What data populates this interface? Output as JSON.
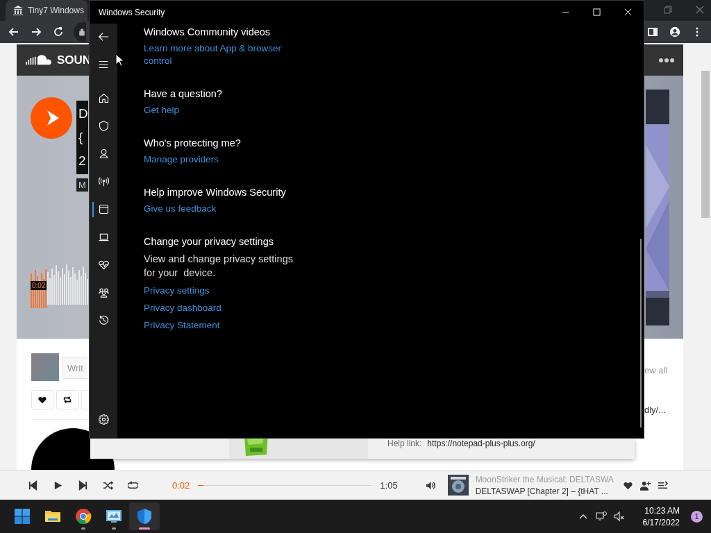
{
  "browser": {
    "tab_title": "Tiny7 Windows"
  },
  "soundcloud": {
    "logo_text": "SOUN",
    "title_lines": [
      "D",
      "{",
      "2"
    ],
    "tag": "M",
    "waveform_time": "0:02",
    "comment_placeholder": "Writ",
    "view_all": "ew all",
    "link_fragment": "dly/..."
  },
  "help_window": {
    "label": "Help link:",
    "url": "https://notepad-plus-plus.org/"
  },
  "player": {
    "elapsed": "0:02",
    "duration": "1:05",
    "level": 0.03,
    "track_artist": "MoonStriker the Musical: DELTASWA",
    "track_title": "DELTASWAP [Chapter 2] – {tHAT ..."
  },
  "security": {
    "title": "Windows Security",
    "nav": [
      {
        "kind": "home",
        "selected": false
      },
      {
        "kind": "shield",
        "selected": false
      },
      {
        "kind": "person",
        "selected": false
      },
      {
        "kind": "antenna",
        "selected": false
      },
      {
        "kind": "window",
        "selected": true
      },
      {
        "kind": "laptop",
        "selected": false
      },
      {
        "kind": "heart-pulse",
        "selected": false
      },
      {
        "kind": "people",
        "selected": false
      },
      {
        "kind": "history",
        "selected": false
      }
    ],
    "sections": [
      {
        "heading": "Windows Community videos",
        "links": [
          "Learn more about App & browser control"
        ]
      },
      {
        "heading": "Have a question?",
        "links": [
          "Get help"
        ]
      },
      {
        "heading": "Who's protecting me?",
        "links": [
          "Manage providers"
        ]
      },
      {
        "heading": "Help improve Windows Security",
        "links": [
          "Give us feedback"
        ]
      },
      {
        "heading": "Change your privacy settings",
        "description": "View and change privacy settings for your  device.",
        "links": [
          "Privacy settings",
          "Privacy dashboard",
          "Privacy Statement"
        ]
      }
    ]
  },
  "taskbar": {
    "apps": [
      {
        "kind": "start",
        "running": false,
        "selected": false
      },
      {
        "kind": "folder",
        "running": false,
        "selected": false
      },
      {
        "kind": "browser",
        "running": true,
        "selected": false
      },
      {
        "kind": "control-panel",
        "running": true,
        "selected": false
      },
      {
        "kind": "shield",
        "running": true,
        "selected": true
      }
    ],
    "time": "10:23 AM",
    "date": "6/17/2022",
    "notification_count": "1"
  }
}
